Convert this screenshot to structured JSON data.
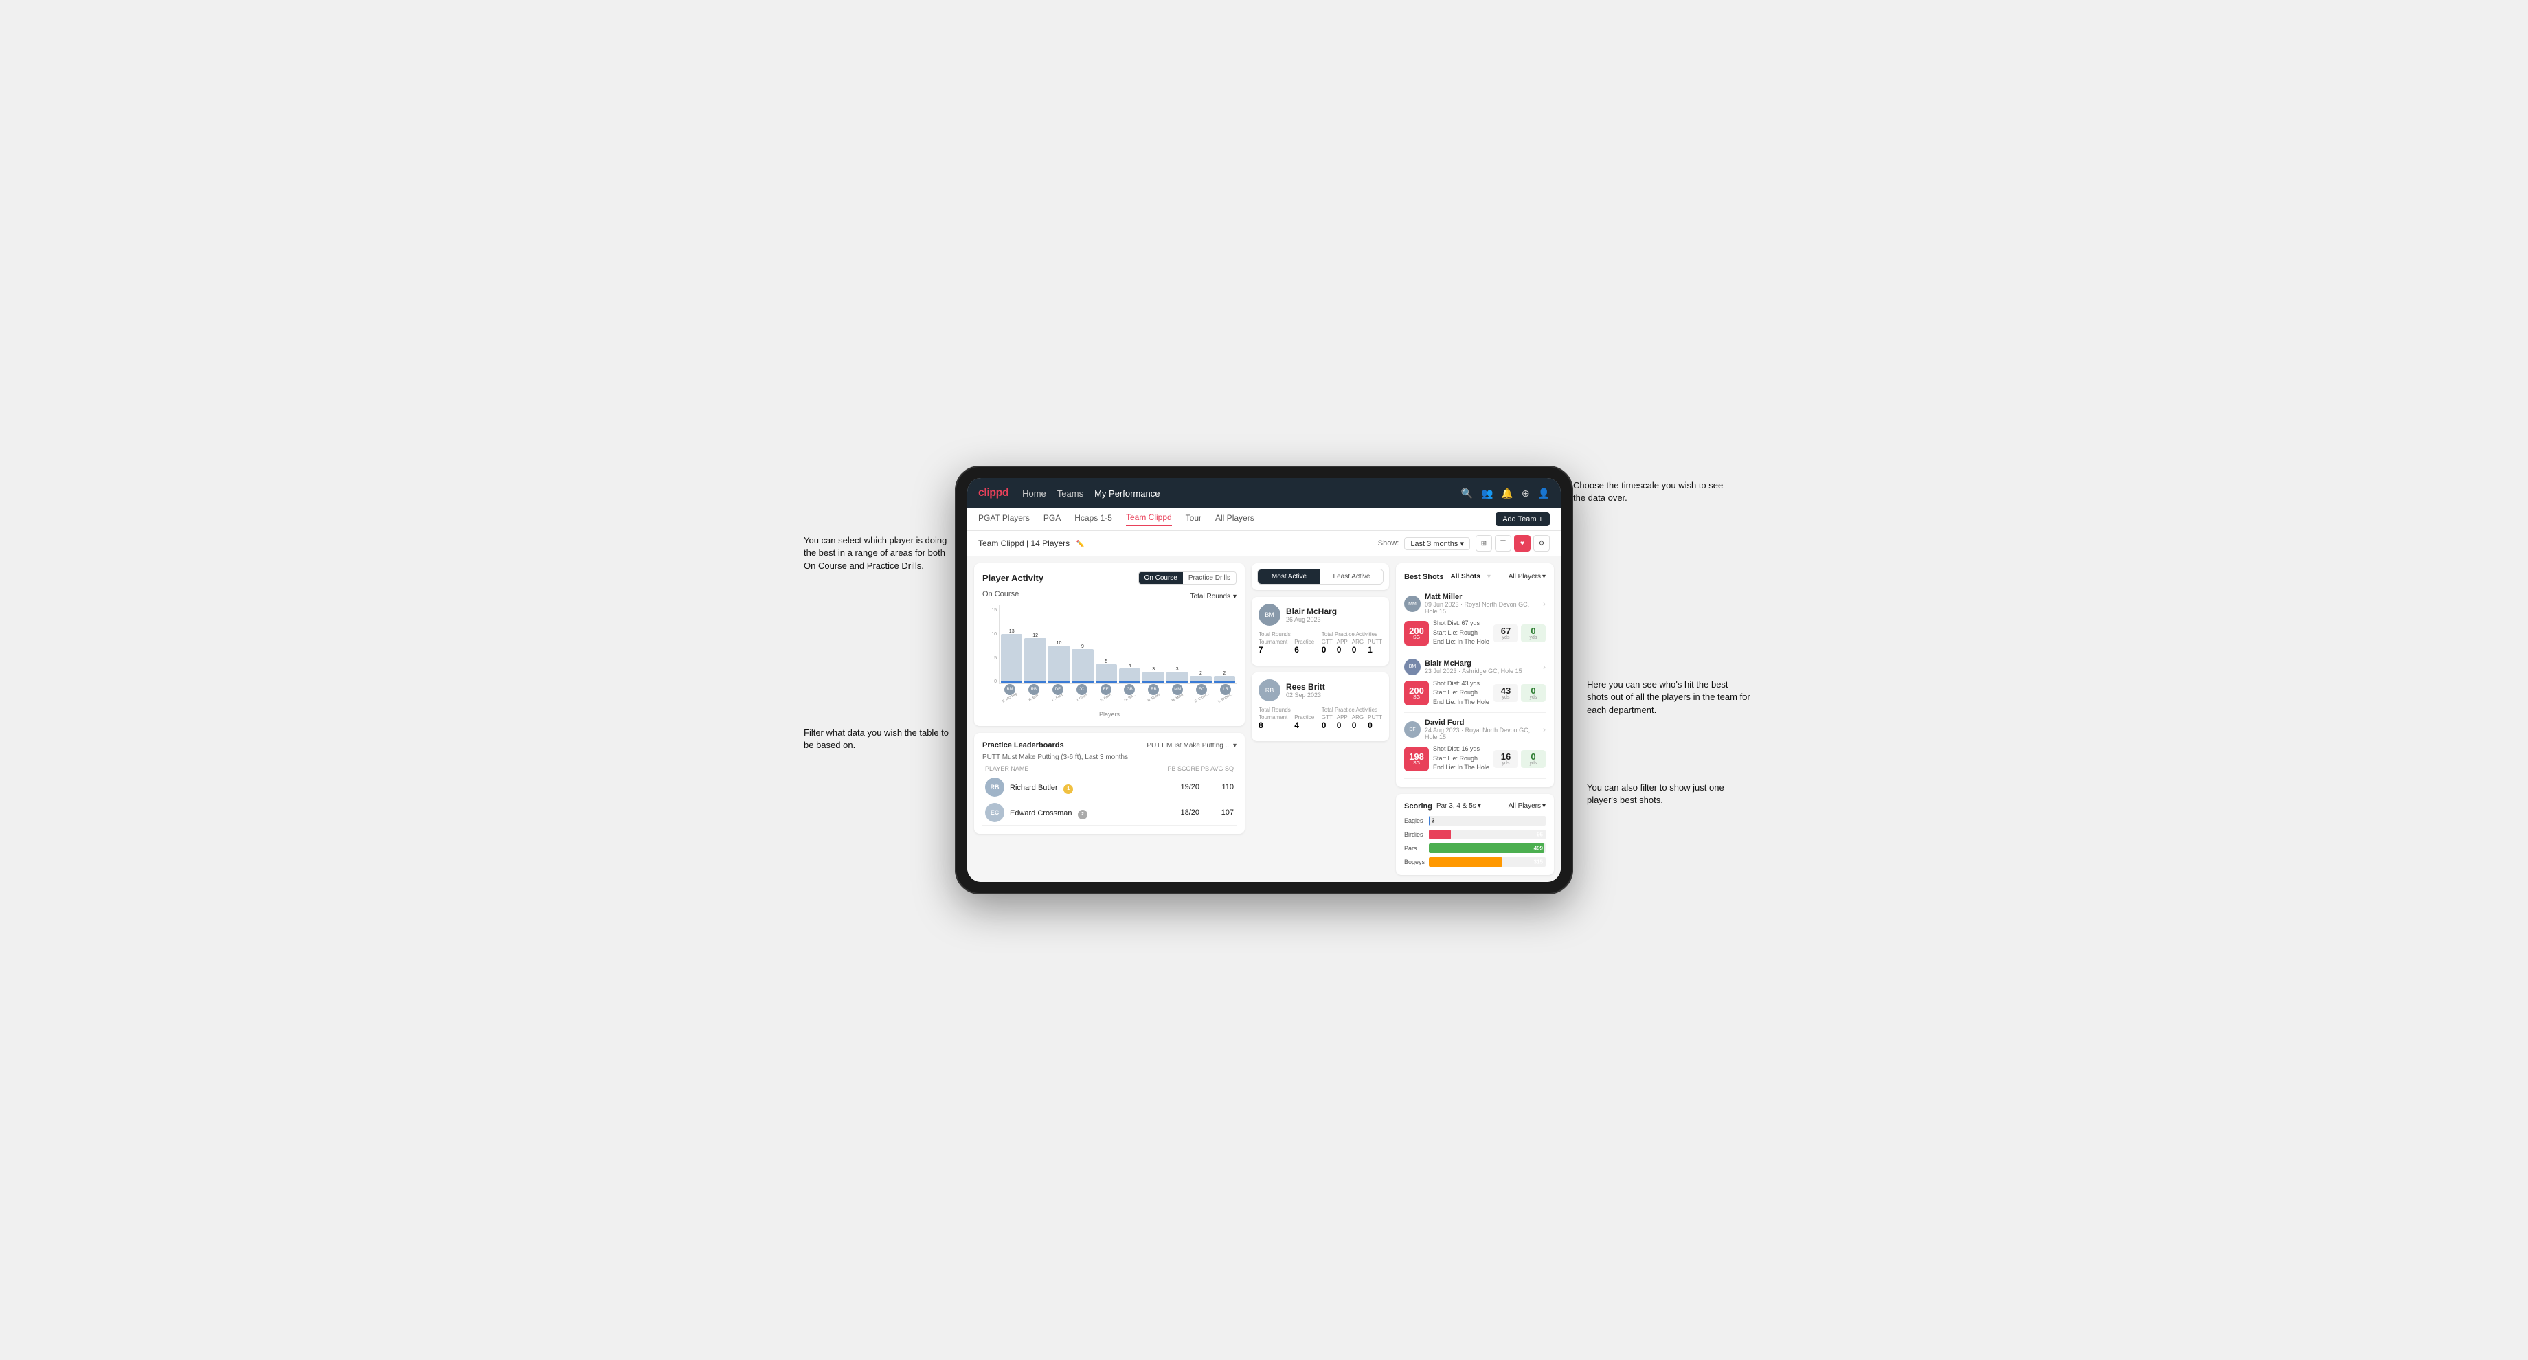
{
  "annotations": {
    "top_right": "Choose the timescale you wish to see the data over.",
    "left_top": "You can select which player is doing the best in a range of areas for both On Course and Practice Drills.",
    "left_bottom": "Filter what data you wish the table to be based on.",
    "right_mid": "Here you can see who's hit the best shots out of all the players in the team for each department.",
    "right_bottom": "You can also filter to show just one player's best shots."
  },
  "nav": {
    "logo": "clippd",
    "links": [
      "Home",
      "Teams",
      "My Performance"
    ],
    "icons": [
      "search",
      "people",
      "bell",
      "add-circle",
      "user"
    ]
  },
  "sub_nav": {
    "links": [
      "PGAT Players",
      "PGA",
      "Hcaps 1-5",
      "Team Clippd",
      "Tour",
      "All Players"
    ],
    "active": "Team Clippd",
    "add_button": "Add Team +"
  },
  "team_header": {
    "title": "Team Clippd | 14 Players",
    "edit_icon": "✏️",
    "show_label": "Show:",
    "show_value": "Last 3 months",
    "view_modes": [
      "grid-view",
      "list-view",
      "heart-view",
      "settings-view"
    ]
  },
  "player_activity": {
    "title": "Player Activity",
    "toggle_on": "On Course",
    "toggle_practice": "Practice Drills",
    "section_label": "On Course",
    "chart_label": "Total Rounds",
    "bars": [
      {
        "player": "B. McHarg",
        "value": 13,
        "color": "#c8d4e0"
      },
      {
        "player": "R. Britt",
        "value": 12,
        "color": "#c8d4e0"
      },
      {
        "player": "D. Ford",
        "value": 10,
        "color": "#c8d4e0"
      },
      {
        "player": "J. Coles",
        "value": 9,
        "color": "#c8d4e0"
      },
      {
        "player": "E. Ebert",
        "value": 5,
        "color": "#c8d4e0"
      },
      {
        "player": "G. Billingham",
        "value": 4,
        "color": "#c8d4e0"
      },
      {
        "player": "R. Butler",
        "value": 3,
        "color": "#c8d4e0"
      },
      {
        "player": "M. Miller",
        "value": 3,
        "color": "#c8d4e0"
      },
      {
        "player": "E. Crossman",
        "value": 2,
        "color": "#c8d4e0"
      },
      {
        "player": "L. Robertson",
        "value": 2,
        "color": "#c8d4e0"
      }
    ],
    "y_labels": [
      "15",
      "10",
      "5",
      "0"
    ],
    "x_label": "Players"
  },
  "practice_leaderboards": {
    "title": "Practice Leaderboards",
    "filter": "PUTT Must Make Putting ...",
    "subtitle": "PUTT Must Make Putting (3-6 ft), Last 3 months",
    "columns": [
      "PLAYER NAME",
      "PB SCORE",
      "PB AVG SQ"
    ],
    "players": [
      {
        "name": "Richard Butler",
        "rank": "1",
        "pb_score": "19/20",
        "pb_avg": "110",
        "avatar_bg": "#a0b4c8"
      },
      {
        "name": "Edward Crossman",
        "rank": "2",
        "pb_score": "18/20",
        "pb_avg": "107",
        "avatar_bg": "#b0c0d0"
      }
    ]
  },
  "most_active": {
    "tab_active": "Most Active",
    "tab_least": "Least Active",
    "players": [
      {
        "name": "Blair McHarg",
        "date": "26 Aug 2023",
        "total_rounds_label": "Total Rounds",
        "tournament": "7",
        "practice": "6",
        "practice_activities_label": "Total Practice Activities",
        "gtt": "0",
        "app": "0",
        "arg": "0",
        "putt": "1"
      },
      {
        "name": "Rees Britt",
        "date": "02 Sep 2023",
        "total_rounds_label": "Total Rounds",
        "tournament": "8",
        "practice": "4",
        "practice_activities_label": "Total Practice Activities",
        "gtt": "0",
        "app": "0",
        "arg": "0",
        "putt": "0"
      }
    ]
  },
  "best_shots": {
    "title": "Best Shots",
    "tab_all": "All Shots",
    "filter_label": "All Players",
    "shots": [
      {
        "player": "Matt Miller",
        "date": "09 Jun 2023",
        "course": "Royal North Devon GC",
        "hole": "Hole 15",
        "badge_num": "200",
        "badge_label": "SG",
        "shot_dist": "Shot Dist: 67 yds",
        "start_lie": "Start Lie: Rough",
        "end_lie": "End Lie: In The Hole",
        "metric1_val": "67",
        "metric1_unit": "yds",
        "metric2_val": "0",
        "metric2_unit": "yds"
      },
      {
        "player": "Blair McHarg",
        "date": "23 Jul 2023",
        "course": "Ashridge GC",
        "hole": "Hole 15",
        "badge_num": "200",
        "badge_label": "SG",
        "shot_dist": "Shot Dist: 43 yds",
        "start_lie": "Start Lie: Rough",
        "end_lie": "End Lie: In The Hole",
        "metric1_val": "43",
        "metric1_unit": "yds",
        "metric2_val": "0",
        "metric2_unit": "yds"
      },
      {
        "player": "David Ford",
        "date": "24 Aug 2023",
        "course": "Royal North Devon GC",
        "hole": "Hole 15",
        "badge_num": "198",
        "badge_label": "SG",
        "shot_dist": "Shot Dist: 16 yds",
        "start_lie": "Start Lie: Rough",
        "end_lie": "End Lie: In The Hole",
        "metric1_val": "16",
        "metric1_unit": "yds",
        "metric2_val": "0",
        "metric2_unit": "yds"
      }
    ]
  },
  "scoring": {
    "title": "Scoring",
    "filter": "Par 3, 4 & 5s",
    "all_players": "All Players",
    "bars": [
      {
        "label": "Eagles",
        "value": 3,
        "max": 500,
        "color": "#3a7bd5",
        "text_color": "#fff"
      },
      {
        "label": "Birdies",
        "value": 96,
        "max": 500,
        "color": "#e8415a",
        "text_color": "#fff"
      },
      {
        "label": "Pars",
        "value": 499,
        "max": 500,
        "color": "#4caf50",
        "text_color": "#fff"
      },
      {
        "label": "Bogeys",
        "value": 315,
        "max": 500,
        "color": "#ff9800",
        "text_color": "#fff"
      }
    ]
  }
}
